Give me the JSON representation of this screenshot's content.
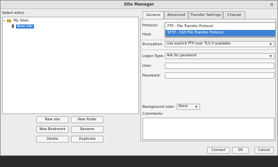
{
  "window": {
    "title": "Site Manager"
  },
  "left": {
    "select_entry_label": "Select entry:",
    "tree": {
      "root_label": "My Sites",
      "selected_item": "New site"
    },
    "buttons": {
      "new_site": "New site",
      "new_folder": "New folder",
      "new_bookmark": "New Bookmark",
      "rename": "Rename",
      "delete": "Delete",
      "duplicate": "Duplicate"
    }
  },
  "tabs": [
    "General",
    "Advanced",
    "Transfer Settings",
    "Charset"
  ],
  "general": {
    "protocol_label": "Protocol:",
    "host_label": "Host:",
    "encryption_label": "Encryption:",
    "encryption_value": "Use explicit FTP over TLS if available",
    "logon_type_label": "Logon Type:",
    "logon_type_value": "Ask for password",
    "user_label": "User:",
    "password_label": "Password:",
    "background_color_label": "Background color:",
    "background_color_value": "None",
    "comments_label": "Comments:"
  },
  "protocol_dropdown": {
    "options": [
      "FTP - File Transfer Protocol",
      "SFTP - SSH File Transfer Protocol"
    ],
    "highlighted": "SFTP - SSH File Transfer Protocol"
  },
  "footer": {
    "connect": "Connect",
    "ok": "OK",
    "cancel": "Cancel"
  },
  "colors": {
    "selection": "#3d83d6",
    "folder": "#e8b74a"
  }
}
